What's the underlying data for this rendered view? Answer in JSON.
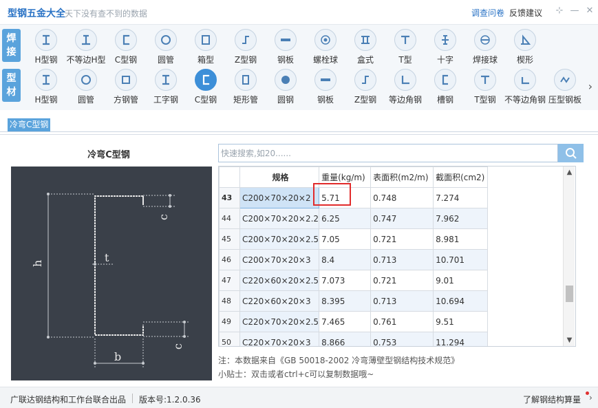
{
  "titlebar": {
    "app_title": "型钢五金大全",
    "slogan": "天下没有查不到的数据",
    "survey_link": "调查问卷",
    "feedback_link": "反馈建议",
    "icons": [
      "pin-icon",
      "minimize-icon",
      "close-icon"
    ]
  },
  "ribbon": {
    "welding_tab": [
      "焊",
      "接"
    ],
    "profile_tab": [
      "型",
      "材"
    ],
    "welding_items": [
      {
        "label": "H型钢",
        "icon": "h-beam-icon"
      },
      {
        "label": "不等边H型",
        "icon": "unequal-h-icon"
      },
      {
        "label": "C型钢",
        "icon": "c-channel-icon"
      },
      {
        "label": "圆管",
        "icon": "round-pipe-icon"
      },
      {
        "label": "箱型",
        "icon": "box-section-icon"
      },
      {
        "label": "Z型钢",
        "icon": "z-section-icon"
      },
      {
        "label": "钢板",
        "icon": "steel-plate-icon"
      },
      {
        "label": "螺栓球",
        "icon": "bolt-ball-icon"
      },
      {
        "label": "盒式",
        "icon": "box-type-icon"
      },
      {
        "label": "T型",
        "icon": "t-section-icon"
      },
      {
        "label": "十字",
        "icon": "cross-section-icon"
      },
      {
        "label": "焊接球",
        "icon": "welded-ball-icon"
      },
      {
        "label": "楔形",
        "icon": "wedge-icon"
      }
    ],
    "profile_items": [
      {
        "label": "H型钢",
        "icon": "h-beam-icon"
      },
      {
        "label": "圆管",
        "icon": "round-pipe-icon"
      },
      {
        "label": "方钢管",
        "icon": "square-tube-icon"
      },
      {
        "label": "工字钢",
        "icon": "i-beam-icon"
      },
      {
        "label": "C型钢",
        "icon": "c-channel-icon",
        "active": true
      },
      {
        "label": "矩形管",
        "icon": "rect-tube-icon"
      },
      {
        "label": "圆钢",
        "icon": "round-bar-icon"
      },
      {
        "label": "钢板",
        "icon": "steel-plate-icon"
      },
      {
        "label": "Z型钢",
        "icon": "z-section-icon"
      },
      {
        "label": "等边角钢",
        "icon": "equal-angle-icon"
      },
      {
        "label": "槽钢",
        "icon": "channel-icon"
      },
      {
        "label": "T型钢",
        "icon": "t-section-icon"
      },
      {
        "label": "不等边角钢",
        "icon": "unequal-angle-icon"
      },
      {
        "label": "压型钢板",
        "icon": "profiled-sheet-icon"
      }
    ]
  },
  "breadcrumb": "冷弯C型钢",
  "figure": {
    "title": "冷弯C型钢",
    "dim_h": "h",
    "dim_b": "b",
    "dim_t": "t",
    "dim_c_top": "c",
    "dim_c_bottom": "c"
  },
  "search": {
    "placeholder": "快速搜索,如20......",
    "icon": "search-icon"
  },
  "table": {
    "headers": [
      "规格",
      "重量(kg/m)",
      "表面积(m2/m)",
      "截面积(cm2)"
    ],
    "rows": [
      {
        "idx": "43",
        "spec": "C200×70×20×2",
        "weight": "5.71",
        "surface": "0.748",
        "area": "7.274"
      },
      {
        "idx": "44",
        "spec": "C200×70×20×2.2",
        "weight": "6.25",
        "surface": "0.747",
        "area": "7.962"
      },
      {
        "idx": "45",
        "spec": "C200×70×20×2.5",
        "weight": "7.05",
        "surface": "0.721",
        "area": "8.981"
      },
      {
        "idx": "46",
        "spec": "C200×70×20×3",
        "weight": "8.4",
        "surface": "0.713",
        "area": "10.701"
      },
      {
        "idx": "47",
        "spec": "C220×60×20×2.5",
        "weight": "7.073",
        "surface": "0.721",
        "area": "9.01"
      },
      {
        "idx": "48",
        "spec": "C220×60×20×3",
        "weight": "8.395",
        "surface": "0.713",
        "area": "10.694"
      },
      {
        "idx": "49",
        "spec": "C220×70×20×2.5",
        "weight": "7.465",
        "surface": "0.761",
        "area": "9.51"
      },
      {
        "idx": "50",
        "spec": "C220×70×20×3",
        "weight": "8.866",
        "surface": "0.753",
        "area": "11.294"
      }
    ]
  },
  "notes": {
    "source": "注：本数据来自《GB  50018-2002  冷弯薄壁型钢结构技术规范》",
    "tip": "小贴士：双击或者ctrl+c可以复制数据哦~"
  },
  "status": {
    "org": "广联达钢结构和工作台联合出品",
    "version": "版本号:1.2.0.36",
    "link": "了解钢结构算量"
  },
  "colors": {
    "accent": "#2a73c5",
    "tab_blue": "#5aa3dc",
    "highlight_red": "#e12a2a",
    "figure_bg": "#3a4049"
  }
}
